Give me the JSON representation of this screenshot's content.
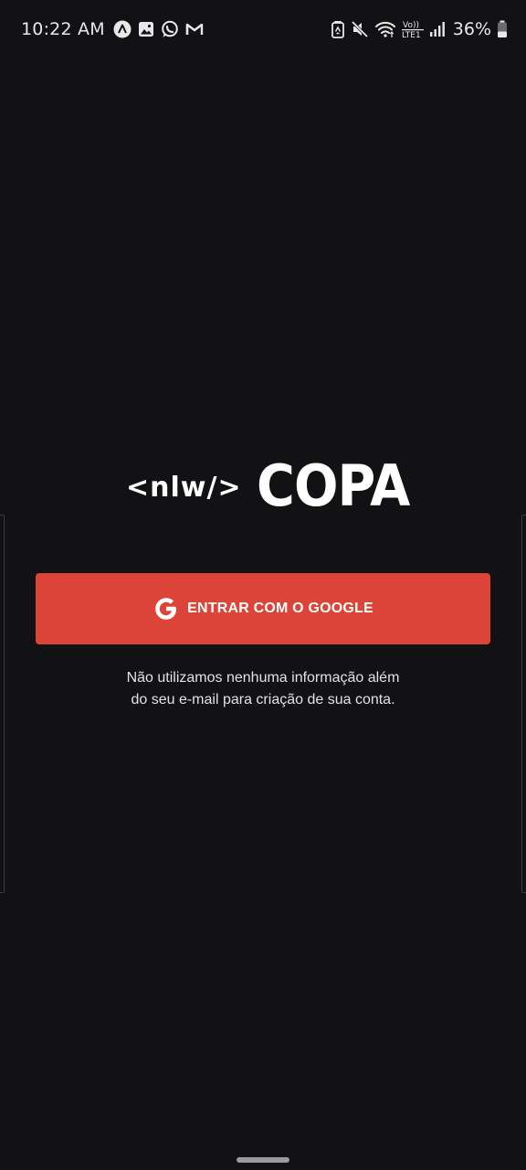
{
  "status_bar": {
    "time": "10:22 AM",
    "notification_icons": [
      "alert-triangle-icon",
      "gallery-icon",
      "whatsapp-icon",
      "gmail-icon"
    ],
    "system_icons": [
      "battery-saver-icon",
      "mute-icon",
      "wifi-icon",
      "volte-icon",
      "signal-icon"
    ],
    "volte_label": "Vo))",
    "lte_label": "LTE1",
    "battery_percent": "36%"
  },
  "logo": {
    "tag": "<nlw/>",
    "name": "COPA"
  },
  "login": {
    "google_button_label": "ENTRAR COM O GOOGLE",
    "button_color": "#db4437"
  },
  "disclaimer": {
    "line1": "Não utilizamos nenhuma informação além",
    "line2": "do seu e-mail para criação de sua conta."
  },
  "colors": {
    "background": "#121214",
    "text": "#ffffff",
    "subtext": "#e1e1e6"
  }
}
